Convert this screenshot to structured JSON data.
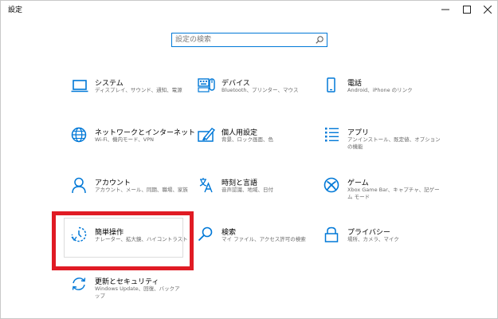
{
  "window": {
    "title": "設定",
    "controls": [
      "minimize",
      "maximize",
      "close"
    ]
  },
  "search": {
    "placeholder": "設定の検索",
    "value": ""
  },
  "accent_color": "#0078d7",
  "highlight_color": "#e01b24",
  "tiles": [
    {
      "id": "system",
      "name": "システム",
      "desc": "ディスプレイ、サウンド、通知、電源",
      "icon": "laptop-icon"
    },
    {
      "id": "devices",
      "name": "デバイス",
      "desc": "Bluetooth、プリンター、マウス",
      "icon": "keyboard-icon"
    },
    {
      "id": "phone",
      "name": "電話",
      "desc": "Android、iPhone のリンク",
      "icon": "phone-icon"
    },
    {
      "id": "network",
      "name": "ネットワークとインターネット",
      "desc": "Wi-Fi、機内モード、VPN",
      "icon": "globe-icon"
    },
    {
      "id": "personalization",
      "name": "個人用設定",
      "desc": "背景、ロック画面、色",
      "icon": "paint-icon"
    },
    {
      "id": "apps",
      "name": "アプリ",
      "desc": "アンインストール、既定値、オプションの機能",
      "icon": "apps-list-icon"
    },
    {
      "id": "accounts",
      "name": "アカウント",
      "desc": "アカウント、メール、同期、職場、家族",
      "icon": "person-icon"
    },
    {
      "id": "time_language",
      "name": "時刻と言語",
      "desc": "音声認識、地域、日付",
      "icon": "language-icon"
    },
    {
      "id": "gaming",
      "name": "ゲーム",
      "desc": "Xbox Game Bar、キャプチャ、記ゲーム モード",
      "icon": "xbox-icon"
    },
    {
      "id": "ease_of_access",
      "name": "簡単操作",
      "desc": "ナレーター、拡大鏡、ハイコントラスト",
      "icon": "ease-of-access-icon"
    },
    {
      "id": "search",
      "name": "検索",
      "desc": "マイ ファイル、アクセス許可の検索",
      "icon": "magnifier-icon"
    },
    {
      "id": "privacy",
      "name": "プライバシー",
      "desc": "場所、カメラ、マイク",
      "icon": "lock-icon"
    },
    {
      "id": "update",
      "name": "更新とセキュリティ",
      "desc": "Windows Update、回復、バックアップ",
      "icon": "sync-icon"
    }
  ]
}
